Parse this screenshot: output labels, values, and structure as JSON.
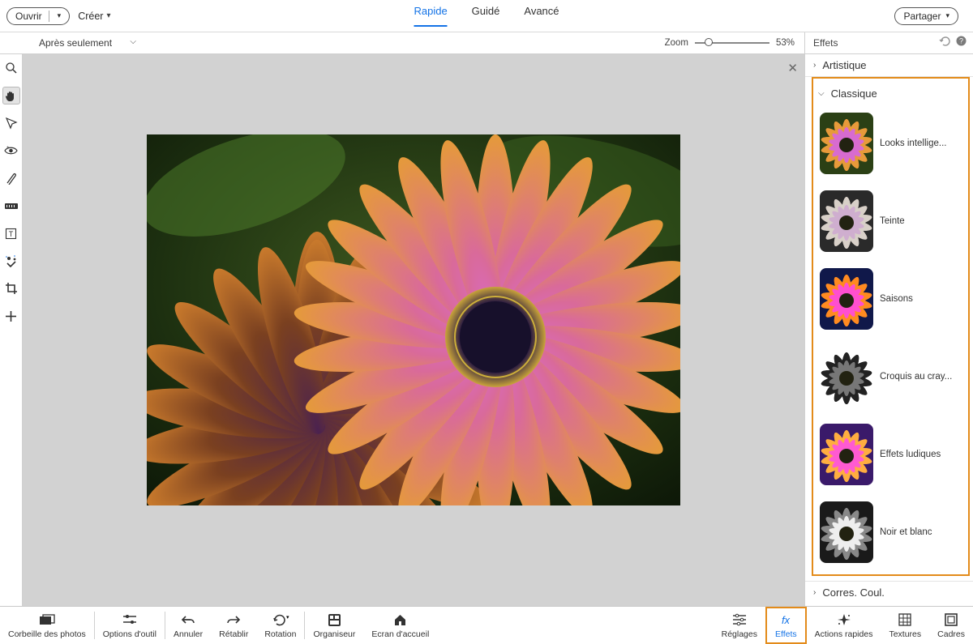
{
  "top": {
    "open": "Ouvrir",
    "create": "Créer",
    "tabs": {
      "quick": "Rapide",
      "guided": "Guidé",
      "advanced": "Avancé"
    },
    "share": "Partager"
  },
  "sub": {
    "view_mode": "Après seulement",
    "zoom_label": "Zoom",
    "zoom_value": "53%",
    "panel_title": "Effets"
  },
  "left_tools": [
    {
      "name": "zoom-tool-icon"
    },
    {
      "name": "hand-tool-icon",
      "active": true
    },
    {
      "name": "quick-select-tool-icon"
    },
    {
      "name": "redeye-tool-icon"
    },
    {
      "name": "whiten-teeth-tool-icon"
    },
    {
      "name": "straighten-tool-icon"
    },
    {
      "name": "type-tool-icon"
    },
    {
      "name": "spot-heal-tool-icon"
    },
    {
      "name": "crop-tool-icon"
    },
    {
      "name": "move-tool-icon"
    }
  ],
  "effects": {
    "artistic": "Artistique",
    "classic": "Classique",
    "items": [
      {
        "label": "Looks intellige...",
        "thumb": "color"
      },
      {
        "label": "Teinte",
        "thumb": "desat"
      },
      {
        "label": "Saisons",
        "thumb": "vivid"
      },
      {
        "label": "Croquis au cray...",
        "thumb": "sketch"
      },
      {
        "label": "Effets ludiques",
        "thumb": "pop"
      },
      {
        "label": "Noir et blanc",
        "thumb": "bw"
      }
    ],
    "color_correct": "Corres. Coul."
  },
  "bottom": {
    "photobin": "Corbeille des photos",
    "toolopts": "Options d'outil",
    "undo": "Annuler",
    "redo": "Rétablir",
    "rotate": "Rotation",
    "organizer": "Organiseur",
    "home": "Ecran d'accueil",
    "adjust": "Réglages",
    "fx": "Effets",
    "quickactions": "Actions rapides",
    "textures": "Textures",
    "frames": "Cadres"
  }
}
